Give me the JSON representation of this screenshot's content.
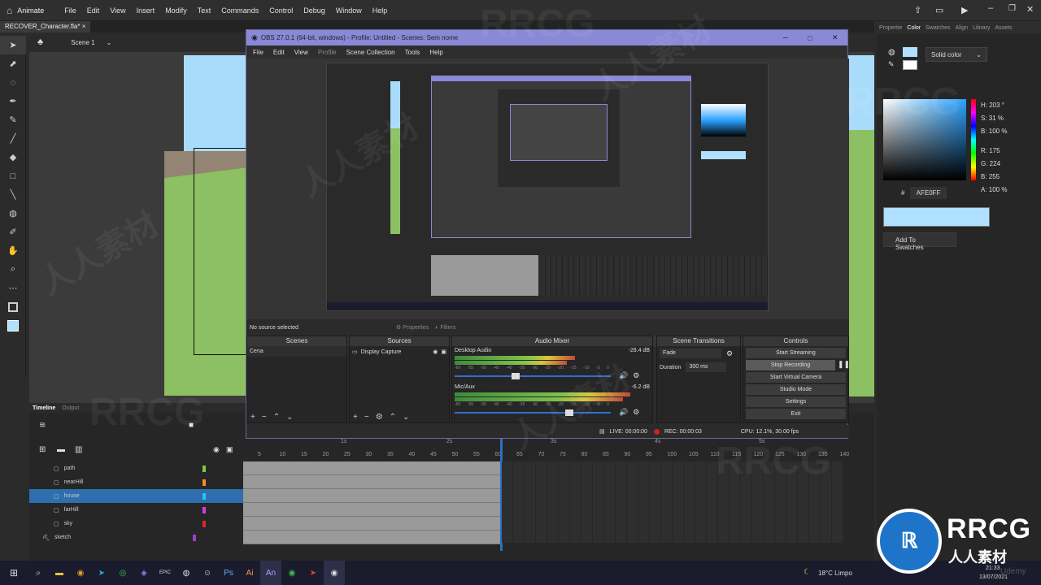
{
  "animate": {
    "app_name": "Animate",
    "menu": [
      "File",
      "Edit",
      "View",
      "Insert",
      "Modify",
      "Text",
      "Commands",
      "Control",
      "Debug",
      "Window",
      "Help"
    ],
    "doc_tab": "RECOVER_Character.fla*",
    "scene": "Scene 1"
  },
  "color_panel": {
    "tabs": [
      "Propertie",
      "Color",
      "Swatches",
      "Align",
      "Library",
      "Assets"
    ],
    "fill_type": "Solid color",
    "h": "H: 203 °",
    "s": "S: 31 %",
    "b": "B: 100 %",
    "r": "R: 175",
    "g": "G: 224",
    "bl": "B: 255",
    "a": "A: 100 %",
    "hex": "AFE0FF",
    "add_swatch": "Add To Swatches",
    "swatch_color": "#afe0ff"
  },
  "timeline": {
    "tabs": [
      "Timeline",
      "Output"
    ],
    "layers": [
      {
        "name": "path",
        "color": "#7bcc3a"
      },
      {
        "name": "nearHill",
        "color": "#f0901e"
      },
      {
        "name": "house",
        "color": "#22c8e8"
      },
      {
        "name": "farHill",
        "color": "#d83ae0"
      },
      {
        "name": "sky",
        "color": "#d82828"
      },
      {
        "name": "sketch",
        "color": "#a040c8"
      }
    ],
    "frames": [
      "5",
      "10",
      "15",
      "20",
      "25",
      "30",
      "35",
      "40",
      "45",
      "50",
      "55",
      "60",
      "65",
      "70",
      "75",
      "80",
      "85",
      "90",
      "95",
      "100",
      "105",
      "110",
      "115",
      "120",
      "125",
      "130",
      "135",
      "140"
    ],
    "seconds": [
      "1s",
      "2s",
      "3s",
      "4s",
      "5s"
    ]
  },
  "obs": {
    "title": "OBS 27.0.1 (64-bit, windows) - Profile: Untitled - Scenes: Sem nome",
    "menu": [
      "File",
      "Edit",
      "View",
      "Profile",
      "Scene Collection",
      "Tools",
      "Help"
    ],
    "no_source": "No source selected",
    "properties": "Properties",
    "filters": "Filters",
    "scenes_h": "Scenes",
    "sources_h": "Sources",
    "mixer_h": "Audio Mixer",
    "transitions_h": "Scene Transitions",
    "controls_h": "Controls",
    "scene_item": "Cena",
    "source_item": "Display Capture",
    "desktop_audio": "Desktop Audio",
    "desktop_db": "-28.4 dB",
    "mic": "Mic/Aux",
    "mic_db": "-6.2 dB",
    "transition": "Fade",
    "duration_label": "Duration",
    "duration": "300 ms",
    "buttons": [
      "Start Streaming",
      "Stop Recording",
      "Start Virtual Camera",
      "Studio Mode",
      "Settings",
      "Exit"
    ],
    "live": "LIVE: 00:00:00",
    "rec": "REC: 00:00:03",
    "cpu": "CPU: 12.1%, 30.00 fps",
    "meter_ticks": [
      "-60",
      "-55",
      "-50",
      "-45",
      "-40",
      "-35",
      "-30",
      "-25",
      "-20",
      "-15",
      "-10",
      "-5",
      "0"
    ]
  },
  "taskbar": {
    "weather": "18°C  Limpo",
    "time": "21:33",
    "date": "13/07/2021",
    "icons": [
      "start-icon",
      "search-icon",
      "files-icon",
      "chrome-icon",
      "telegram-icon",
      "whatsapp-icon",
      "discord-icon",
      "epic-icon",
      "steam-icon",
      "ghost-icon",
      "ps-icon",
      "ai-icon",
      "an-icon",
      "spotify-icon",
      "arrow-icon",
      "obs-icon"
    ],
    "icon_labels": {
      "epic": "EPIC",
      "ps": "Ps",
      "ai": "Ai",
      "an": "An"
    }
  },
  "watermark": {
    "brand": "RRCG",
    "sub": "人人素材",
    "wm": "RRCG",
    "wm_cn": "人人素材",
    "udemy": "Udemy"
  }
}
